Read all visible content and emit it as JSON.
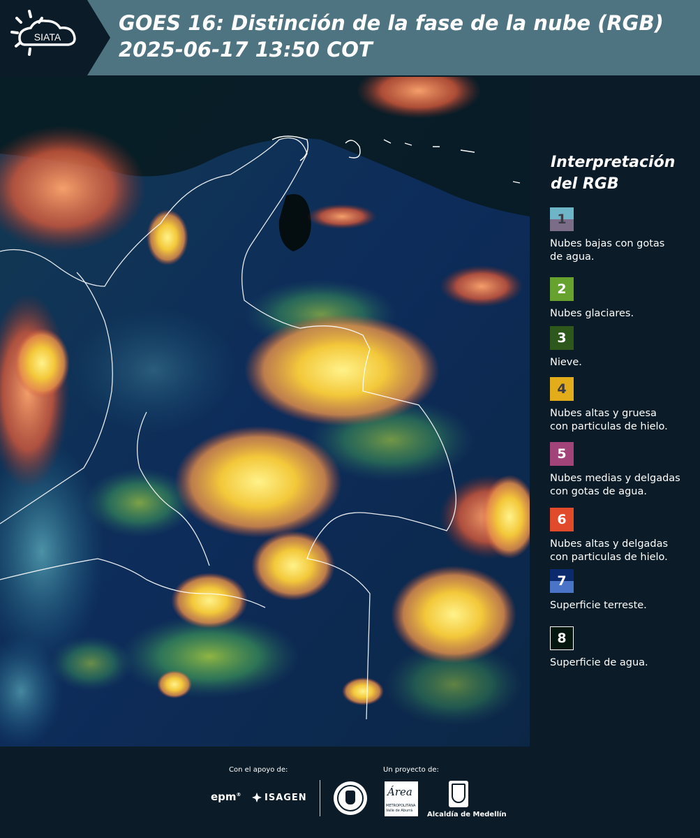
{
  "header": {
    "logo_text": "SIATA",
    "title_line1": "GOES 16: Distinción de la fase de la nube (RGB)",
    "title_line2": " 2025-06-17 13:50 COT"
  },
  "legend": {
    "title_line1": "Interpretación",
    "title_line2": "del RGB",
    "items": [
      {
        "num": "1",
        "label_l1": "Nubes bajas con gotas",
        "label_l2": "de agua.",
        "color_top": "#6eb5c7",
        "color_bottom": "#7b6c87",
        "num_color": "#3b3b48"
      },
      {
        "num": "2",
        "label_l1": "Nubes glaciares.",
        "label_l2": "",
        "color_top": "#67a12e",
        "color_bottom": "#67a12e",
        "num_color": "#ffffff"
      },
      {
        "num": "3",
        "label_l1": "Nieve.",
        "label_l2": "",
        "color_top": "#2e571c",
        "color_bottom": "#2e571c",
        "num_color": "#ffffff"
      },
      {
        "num": "4",
        "label_l1": "Nubes altas y gruesa",
        "label_l2": "con particulas de hielo.",
        "color_top": "#e3ac1b",
        "color_bottom": "#e3ac1b",
        "num_color": "#3b3b48"
      },
      {
        "num": "5",
        "label_l1": "Nubes medias y delgadas",
        "label_l2": "con gotas de agua.",
        "color_top": "#a2447a",
        "color_bottom": "#a2447a",
        "num_color": "#ffffff"
      },
      {
        "num": "6",
        "label_l1": "Nubes altas y delgadas",
        "label_l2": "con particulas de hielo.",
        "color_top": "#e14a2a",
        "color_bottom": "#e14a2a",
        "num_color": "#ffffff"
      },
      {
        "num": "7",
        "label_l1": "Superficie terreste.",
        "label_l2": "",
        "color_top": "#0b2a6e",
        "color_bottom": "#4a74c8",
        "num_color": "#ffffff"
      },
      {
        "num": "8",
        "label_l1": "Superficie de agua.",
        "label_l2": "",
        "color_top": "#06170f",
        "color_bottom": "#06170f",
        "num_color": "#ffffff"
      }
    ]
  },
  "footer": {
    "support_label": "Con el apoyo de:",
    "project_label": "Un proyecto de:",
    "epm": "epm",
    "isagen": "ISAGEN",
    "area_logo": "Área",
    "area_sub1": "METROPOLITANA",
    "area_sub2": "Valle de Aburrá",
    "alcaldia": "Alcaldía de Medellín"
  },
  "colors": {
    "header_bg": "#4f7481",
    "panel_bg": "#0b1c28",
    "accent_yellow": "#f3c83a",
    "accent_orange": "#e57a3a"
  }
}
